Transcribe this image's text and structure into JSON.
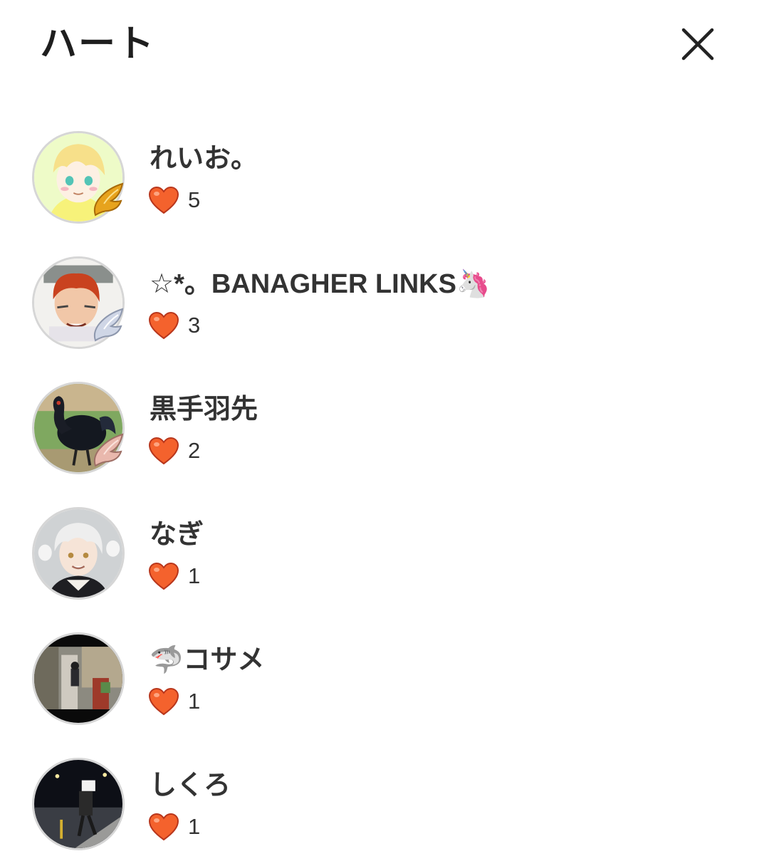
{
  "header": {
    "title": "ハート",
    "close_icon": "close-icon"
  },
  "colors": {
    "heart": "#f4622d",
    "heart_outline": "#b8361c",
    "text": "#333333",
    "avatar_border": "#d6d6d6"
  },
  "users": [
    {
      "name": "れいお。",
      "hearts": "5",
      "badge": "gold"
    },
    {
      "name": "☆*。BANAGHER LINKS🦄",
      "hearts": "3",
      "badge": "silver"
    },
    {
      "name": "黒手羽先",
      "hearts": "2",
      "badge": "pink"
    },
    {
      "name": "なぎ",
      "hearts": "1",
      "badge": ""
    },
    {
      "name": "🦈コサメ",
      "hearts": "1",
      "badge": ""
    },
    {
      "name": "しくろ",
      "hearts": "1",
      "badge": ""
    }
  ]
}
